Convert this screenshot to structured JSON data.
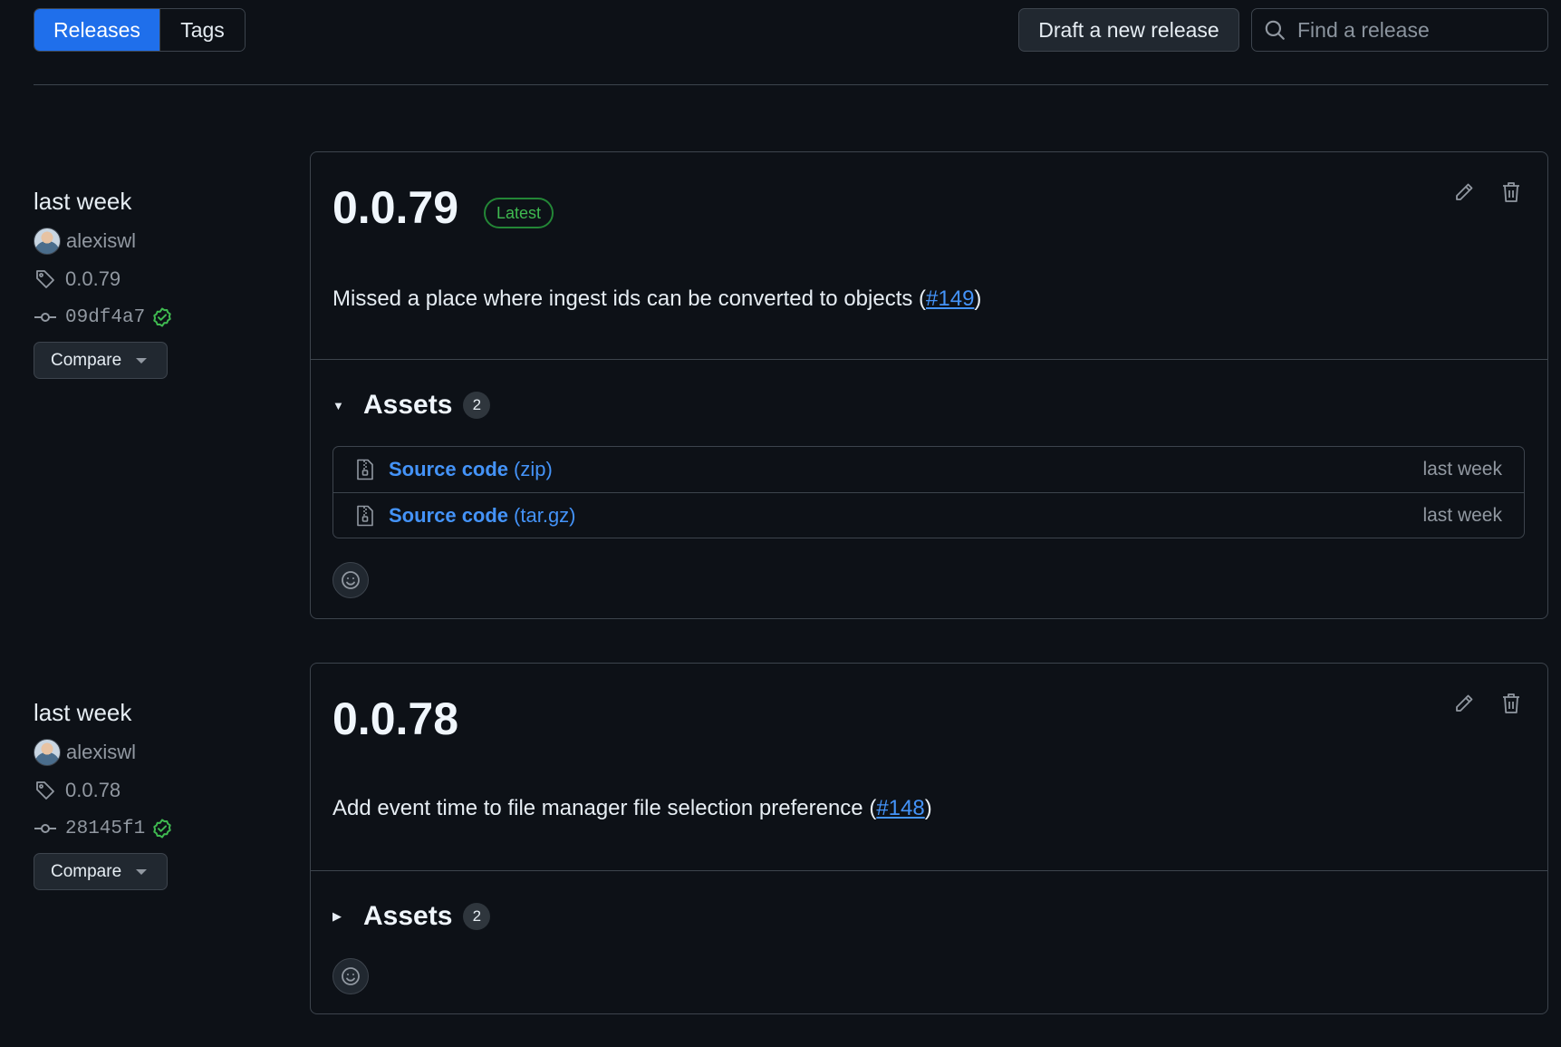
{
  "topbar": {
    "releases_tab": "Releases",
    "tags_tab": "Tags",
    "draft_button": "Draft a new release",
    "search_placeholder": "Find a release"
  },
  "colors": {
    "background": "#0d1117",
    "accent": "#1f6feb",
    "link": "#4493f8",
    "success": "#3fb950"
  },
  "releases": [
    {
      "date": "last week",
      "author": "alexiswl",
      "tag": "0.0.79",
      "commit": "09df4a7",
      "verified": true,
      "compare_label": "Compare",
      "version": "0.0.79",
      "badge": "Latest",
      "description_prefix": "Missed a place where ingest ids can be converted to objects (",
      "pr_link": "#149",
      "description_suffix": ")",
      "assets_label": "Assets",
      "assets_count": "2",
      "assets_expanded": true,
      "assets": [
        {
          "name": "Source code",
          "ext": "(zip)",
          "when": "last week"
        },
        {
          "name": "Source code",
          "ext": "(tar.gz)",
          "when": "last week"
        }
      ]
    },
    {
      "date": "last week",
      "author": "alexiswl",
      "tag": "0.0.78",
      "commit": "28145f1",
      "verified": true,
      "compare_label": "Compare",
      "version": "0.0.78",
      "description_prefix": "Add event time to file manager file selection preference (",
      "pr_link": "#148",
      "description_suffix": ")",
      "assets_label": "Assets",
      "assets_count": "2",
      "assets_expanded": false
    }
  ],
  "icons": {
    "search": "search-icon",
    "avatar": "avatar",
    "tag": "tag-icon",
    "commit": "commit-icon",
    "verified": "check-circle-icon",
    "edit": "pencil-icon",
    "delete": "trash-icon",
    "zip": "file-zip-icon",
    "reaction": "smiley-icon"
  }
}
